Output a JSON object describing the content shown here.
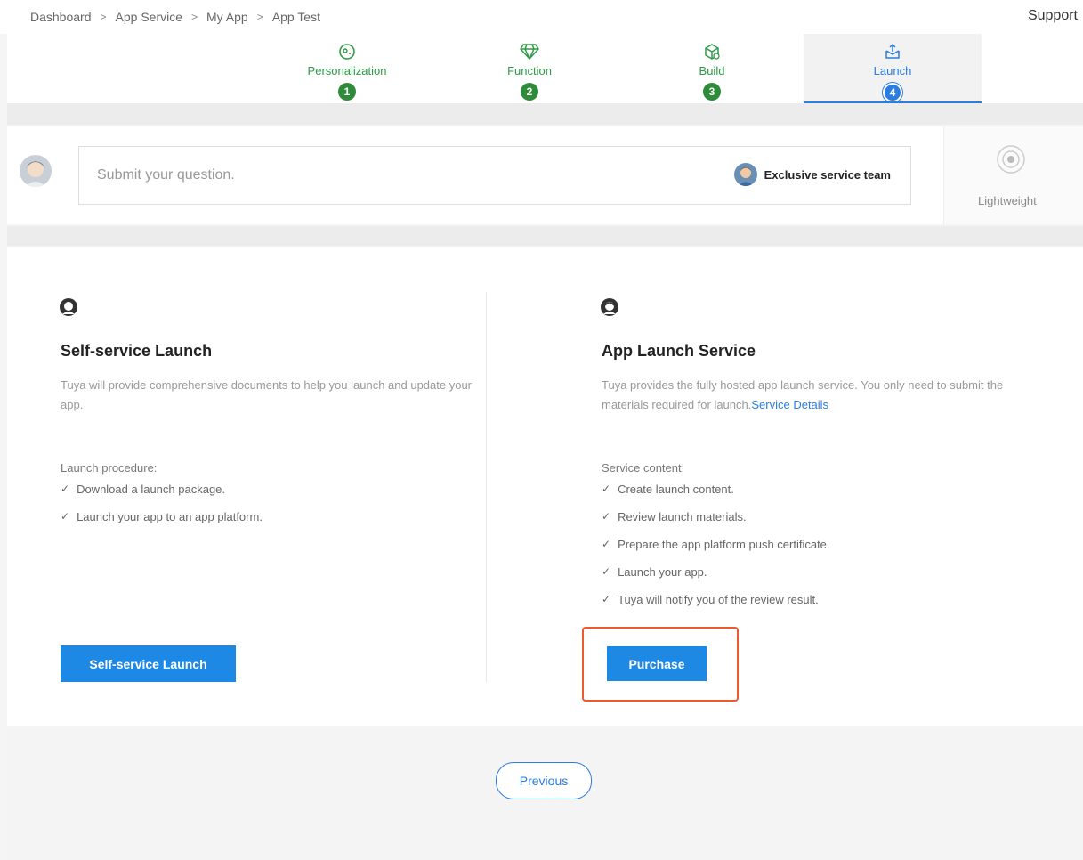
{
  "breadcrumb": [
    "Dashboard",
    "App Service",
    "My App",
    "App Test"
  ],
  "header": {
    "support_label": "Support"
  },
  "steps": [
    {
      "label": "Personalization",
      "number": "1",
      "icon": "palette-icon"
    },
    {
      "label": "Function",
      "number": "2",
      "icon": "diamond-icon"
    },
    {
      "label": "Build",
      "number": "3",
      "icon": "box-icon"
    },
    {
      "label": "Launch",
      "number": "4",
      "icon": "upload-icon"
    }
  ],
  "active_step": 4,
  "question": {
    "placeholder": "Submit your question.",
    "team_label": "Exclusive service team",
    "lightweight_label": "Lightweight"
  },
  "self_service": {
    "title": "Self-service Launch",
    "description": "Tuya will provide comprehensive documents to help you launch and update your app.",
    "list_title": "Launch procedure:",
    "items": [
      "Download a launch package.",
      "Launch your app to an app platform."
    ],
    "button": "Self-service Launch"
  },
  "app_launch": {
    "title": "App Launch Service",
    "description": "Tuya provides the fully hosted app launch service. You only need to submit the materials required for launch.",
    "details_link": "Service Details",
    "list_title": "Service content:",
    "items": [
      "Create launch content.",
      "Review launch materials.",
      "Prepare the app platform push certificate.",
      "Launch your app.",
      "Tuya will notify you of the review result."
    ],
    "button": "Purchase"
  },
  "footer": {
    "previous_label": "Previous"
  },
  "colors": {
    "accent": "#1e88e5",
    "step_done": "#2e8b3a",
    "highlight": "#ef5a2d"
  }
}
